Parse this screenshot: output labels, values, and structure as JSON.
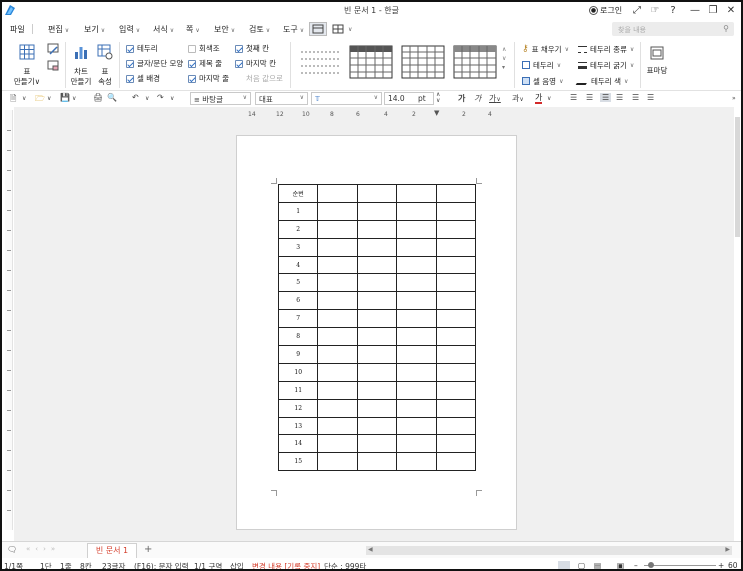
{
  "window": {
    "title": "빈 문서 1 - 한글",
    "login_label": "로그인"
  },
  "menu": {
    "items": [
      "파일",
      "편집",
      "보기",
      "입력",
      "서식",
      "쪽",
      "보안",
      "검토",
      "도구"
    ],
    "search_placeholder": "찾을 내용"
  },
  "ribbon": {
    "table_make": "표\n만들기",
    "chart_make": "차트\n만들기",
    "table_props": "표\n속성",
    "checks_col1": [
      {
        "label": "테두리",
        "checked": true
      },
      {
        "label": "글자/문단 모양",
        "checked": true
      },
      {
        "label": "셀 배경",
        "checked": true
      }
    ],
    "checks_col2": [
      {
        "label": "회색조",
        "checked": false
      },
      {
        "label": "제목 줄",
        "checked": true
      },
      {
        "label": "마지막 줄",
        "checked": true
      }
    ],
    "checks_col3": [
      {
        "label": "첫째 칸",
        "checked": true
      },
      {
        "label": "마지막 칸",
        "checked": true
      },
      {
        "label": "처음 값으로",
        "checked": false,
        "disabled": true
      }
    ],
    "right_col1": [
      "표 채우기",
      "테두리",
      "셀 음영"
    ],
    "right_col2": [
      "테두리 종류",
      "테두리 굵기",
      "테두리 색"
    ],
    "table_props_big": "표마당"
  },
  "toolbar": {
    "style_value": "바탕글",
    "font_group_value": "대표",
    "font_value": "",
    "size_value": "14.0",
    "size_unit": "pt",
    "char_buttons": [
      "가",
      "가",
      "가",
      "과",
      "가"
    ]
  },
  "ruler": {
    "labels": [
      "14",
      "12",
      "10",
      "8",
      "6",
      "4",
      "2",
      "2",
      "4"
    ]
  },
  "document": {
    "header_cell": "순번",
    "row_numbers": [
      "1",
      "2",
      "3",
      "4",
      "5",
      "6",
      "7",
      "8",
      "9",
      "10",
      "11",
      "12",
      "13",
      "14",
      "15"
    ],
    "columns": 5
  },
  "tabs": {
    "active_tab": "빈 문서 1",
    "add_tab": "+"
  },
  "status": {
    "items": [
      "1/1쪽",
      "1단",
      "1줄",
      "8칸",
      "23글자",
      "(F16): 문자 입력",
      "1/1 구역",
      "삽입"
    ],
    "change_tracking": "변경 내용 [기록 중지]",
    "language": "단순 : 999타",
    "zoom": "60"
  }
}
